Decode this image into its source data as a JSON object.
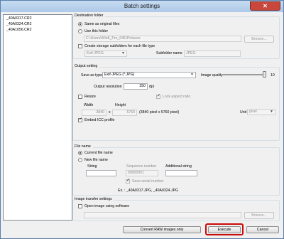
{
  "window": {
    "title": "Batch settings",
    "close_icon": "close-icon"
  },
  "files": [
    "_40A0317.CR2",
    "_40A0324.CR2",
    "_40A1056.CR2"
  ],
  "destination": {
    "header": "Destination folder",
    "same_label": "Same as original files",
    "use_label": "Use this folder",
    "path": "C:\\Users\\Win8_Pro_64E\\Pictures",
    "browse": "Browse...",
    "subfolders_label": "Create storage subfolders for each file type",
    "subtype_value": "Exif-JPEG",
    "subfolder_name_label": "Subfolder name",
    "subfolder_name_value": "JPEG"
  },
  "output": {
    "header": "Output setting",
    "save_as_label": "Save as type",
    "save_as_value": "Exif-JPEG (*.JPG)",
    "quality_label": "Image quality",
    "quality_value": "10",
    "quality_level": 10,
    "quality_max": 10,
    "resolution_label": "Output resolution",
    "resolution_value": "350",
    "resolution_unit": "dpi",
    "resize_label": "Resize",
    "lock_label": "Lock aspect ratio",
    "width_label": "Width",
    "height_label": "Height",
    "width_value": "3840",
    "times": "x",
    "height_value": "5760",
    "pixel_info": "(3840 pixel x 5760 pixel)",
    "unit_label": "Unit",
    "unit_value": "pixel",
    "embed_label": "Embed ICC profile"
  },
  "filename": {
    "header": "File name",
    "current_label": "Current file name",
    "new_label": "New file name",
    "string_label": "String",
    "seq_label": "Sequence number",
    "seq_value": "00000001",
    "add_label": "Additional string",
    "save_serial_label": "Save serial number",
    "example": "Ex. :   _40A0317.JPG, _40A0324.JPG"
  },
  "transfer": {
    "header": "Image transfer settings",
    "open_label": "Open image using software",
    "browse": "Browse..."
  },
  "footer": {
    "convert": "Convert RAW images only",
    "execute": "Execute",
    "cancel": "Cancel"
  }
}
